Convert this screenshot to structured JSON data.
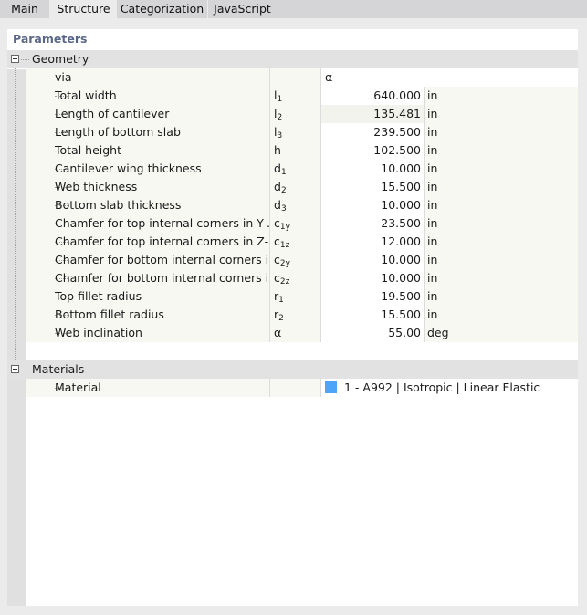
{
  "tabs": [
    {
      "label": "Main",
      "active": false
    },
    {
      "label": "Structure",
      "active": true
    },
    {
      "label": "Categorization",
      "active": false
    },
    {
      "label": "JavaScript",
      "active": false
    }
  ],
  "panel_title": "Parameters",
  "geometry": {
    "label": "Geometry",
    "via": {
      "label": "via",
      "value": "α"
    },
    "rows": [
      {
        "label": "Total width",
        "sym": "l",
        "sub": "1",
        "value": "640.000",
        "unit": "in"
      },
      {
        "label": "Length of cantilever",
        "sym": "l",
        "sub": "2",
        "value": "135.481",
        "unit": "in"
      },
      {
        "label": "Length of bottom slab",
        "sym": "l",
        "sub": "3",
        "value": "239.500",
        "unit": "in"
      },
      {
        "label": "Total height",
        "sym": "h",
        "sub": "",
        "value": "102.500",
        "unit": "in"
      },
      {
        "label": "Cantilever wing thickness",
        "sym": "d",
        "sub": "1",
        "value": "10.000",
        "unit": "in"
      },
      {
        "label": "Web thickness",
        "sym": "d",
        "sub": "2",
        "value": "15.500",
        "unit": "in"
      },
      {
        "label": "Bottom slab thickness",
        "sym": "d",
        "sub": "3",
        "value": "10.000",
        "unit": "in"
      },
      {
        "label": "Chamfer for top internal corners in Y-...",
        "sym": "c",
        "sub": "1y",
        "value": "23.500",
        "unit": "in"
      },
      {
        "label": "Chamfer for top internal corners in Z-...",
        "sym": "c",
        "sub": "1z",
        "value": "12.000",
        "unit": "in"
      },
      {
        "label": "Chamfer for bottom internal corners i...",
        "sym": "c",
        "sub": "2y",
        "value": "10.000",
        "unit": "in"
      },
      {
        "label": "Chamfer for bottom internal corners i...",
        "sym": "c",
        "sub": "2z",
        "value": "10.000",
        "unit": "in"
      },
      {
        "label": "Top fillet radius",
        "sym": "r",
        "sub": "1",
        "value": "19.500",
        "unit": "in"
      },
      {
        "label": "Bottom fillet radius",
        "sym": "r",
        "sub": "2",
        "value": "15.500",
        "unit": "in"
      },
      {
        "label": "Web inclination",
        "sym": "α",
        "sub": "",
        "value": "55.00",
        "unit": "deg"
      }
    ]
  },
  "materials": {
    "label": "Materials",
    "rows": [
      {
        "label": "Material",
        "value": "1 - A992 | Isotropic | Linear Elastic",
        "swatch_color": "#4ea4f8"
      }
    ]
  }
}
